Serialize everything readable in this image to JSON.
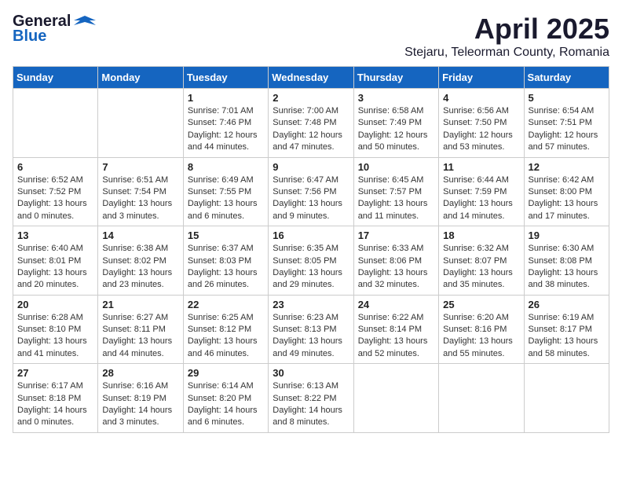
{
  "logo": {
    "general": "General",
    "blue": "Blue"
  },
  "title": "April 2025",
  "subtitle": "Stejaru, Teleorman County, Romania",
  "days": [
    "Sunday",
    "Monday",
    "Tuesday",
    "Wednesday",
    "Thursday",
    "Friday",
    "Saturday"
  ],
  "weeks": [
    [
      {
        "num": "",
        "info": ""
      },
      {
        "num": "",
        "info": ""
      },
      {
        "num": "1",
        "info": "Sunrise: 7:01 AM\nSunset: 7:46 PM\nDaylight: 12 hours and 44 minutes."
      },
      {
        "num": "2",
        "info": "Sunrise: 7:00 AM\nSunset: 7:48 PM\nDaylight: 12 hours and 47 minutes."
      },
      {
        "num": "3",
        "info": "Sunrise: 6:58 AM\nSunset: 7:49 PM\nDaylight: 12 hours and 50 minutes."
      },
      {
        "num": "4",
        "info": "Sunrise: 6:56 AM\nSunset: 7:50 PM\nDaylight: 12 hours and 53 minutes."
      },
      {
        "num": "5",
        "info": "Sunrise: 6:54 AM\nSunset: 7:51 PM\nDaylight: 12 hours and 57 minutes."
      }
    ],
    [
      {
        "num": "6",
        "info": "Sunrise: 6:52 AM\nSunset: 7:52 PM\nDaylight: 13 hours and 0 minutes."
      },
      {
        "num": "7",
        "info": "Sunrise: 6:51 AM\nSunset: 7:54 PM\nDaylight: 13 hours and 3 minutes."
      },
      {
        "num": "8",
        "info": "Sunrise: 6:49 AM\nSunset: 7:55 PM\nDaylight: 13 hours and 6 minutes."
      },
      {
        "num": "9",
        "info": "Sunrise: 6:47 AM\nSunset: 7:56 PM\nDaylight: 13 hours and 9 minutes."
      },
      {
        "num": "10",
        "info": "Sunrise: 6:45 AM\nSunset: 7:57 PM\nDaylight: 13 hours and 11 minutes."
      },
      {
        "num": "11",
        "info": "Sunrise: 6:44 AM\nSunset: 7:59 PM\nDaylight: 13 hours and 14 minutes."
      },
      {
        "num": "12",
        "info": "Sunrise: 6:42 AM\nSunset: 8:00 PM\nDaylight: 13 hours and 17 minutes."
      }
    ],
    [
      {
        "num": "13",
        "info": "Sunrise: 6:40 AM\nSunset: 8:01 PM\nDaylight: 13 hours and 20 minutes."
      },
      {
        "num": "14",
        "info": "Sunrise: 6:38 AM\nSunset: 8:02 PM\nDaylight: 13 hours and 23 minutes."
      },
      {
        "num": "15",
        "info": "Sunrise: 6:37 AM\nSunset: 8:03 PM\nDaylight: 13 hours and 26 minutes."
      },
      {
        "num": "16",
        "info": "Sunrise: 6:35 AM\nSunset: 8:05 PM\nDaylight: 13 hours and 29 minutes."
      },
      {
        "num": "17",
        "info": "Sunrise: 6:33 AM\nSunset: 8:06 PM\nDaylight: 13 hours and 32 minutes."
      },
      {
        "num": "18",
        "info": "Sunrise: 6:32 AM\nSunset: 8:07 PM\nDaylight: 13 hours and 35 minutes."
      },
      {
        "num": "19",
        "info": "Sunrise: 6:30 AM\nSunset: 8:08 PM\nDaylight: 13 hours and 38 minutes."
      }
    ],
    [
      {
        "num": "20",
        "info": "Sunrise: 6:28 AM\nSunset: 8:10 PM\nDaylight: 13 hours and 41 minutes."
      },
      {
        "num": "21",
        "info": "Sunrise: 6:27 AM\nSunset: 8:11 PM\nDaylight: 13 hours and 44 minutes."
      },
      {
        "num": "22",
        "info": "Sunrise: 6:25 AM\nSunset: 8:12 PM\nDaylight: 13 hours and 46 minutes."
      },
      {
        "num": "23",
        "info": "Sunrise: 6:23 AM\nSunset: 8:13 PM\nDaylight: 13 hours and 49 minutes."
      },
      {
        "num": "24",
        "info": "Sunrise: 6:22 AM\nSunset: 8:14 PM\nDaylight: 13 hours and 52 minutes."
      },
      {
        "num": "25",
        "info": "Sunrise: 6:20 AM\nSunset: 8:16 PM\nDaylight: 13 hours and 55 minutes."
      },
      {
        "num": "26",
        "info": "Sunrise: 6:19 AM\nSunset: 8:17 PM\nDaylight: 13 hours and 58 minutes."
      }
    ],
    [
      {
        "num": "27",
        "info": "Sunrise: 6:17 AM\nSunset: 8:18 PM\nDaylight: 14 hours and 0 minutes."
      },
      {
        "num": "28",
        "info": "Sunrise: 6:16 AM\nSunset: 8:19 PM\nDaylight: 14 hours and 3 minutes."
      },
      {
        "num": "29",
        "info": "Sunrise: 6:14 AM\nSunset: 8:20 PM\nDaylight: 14 hours and 6 minutes."
      },
      {
        "num": "30",
        "info": "Sunrise: 6:13 AM\nSunset: 8:22 PM\nDaylight: 14 hours and 8 minutes."
      },
      {
        "num": "",
        "info": ""
      },
      {
        "num": "",
        "info": ""
      },
      {
        "num": "",
        "info": ""
      }
    ]
  ]
}
